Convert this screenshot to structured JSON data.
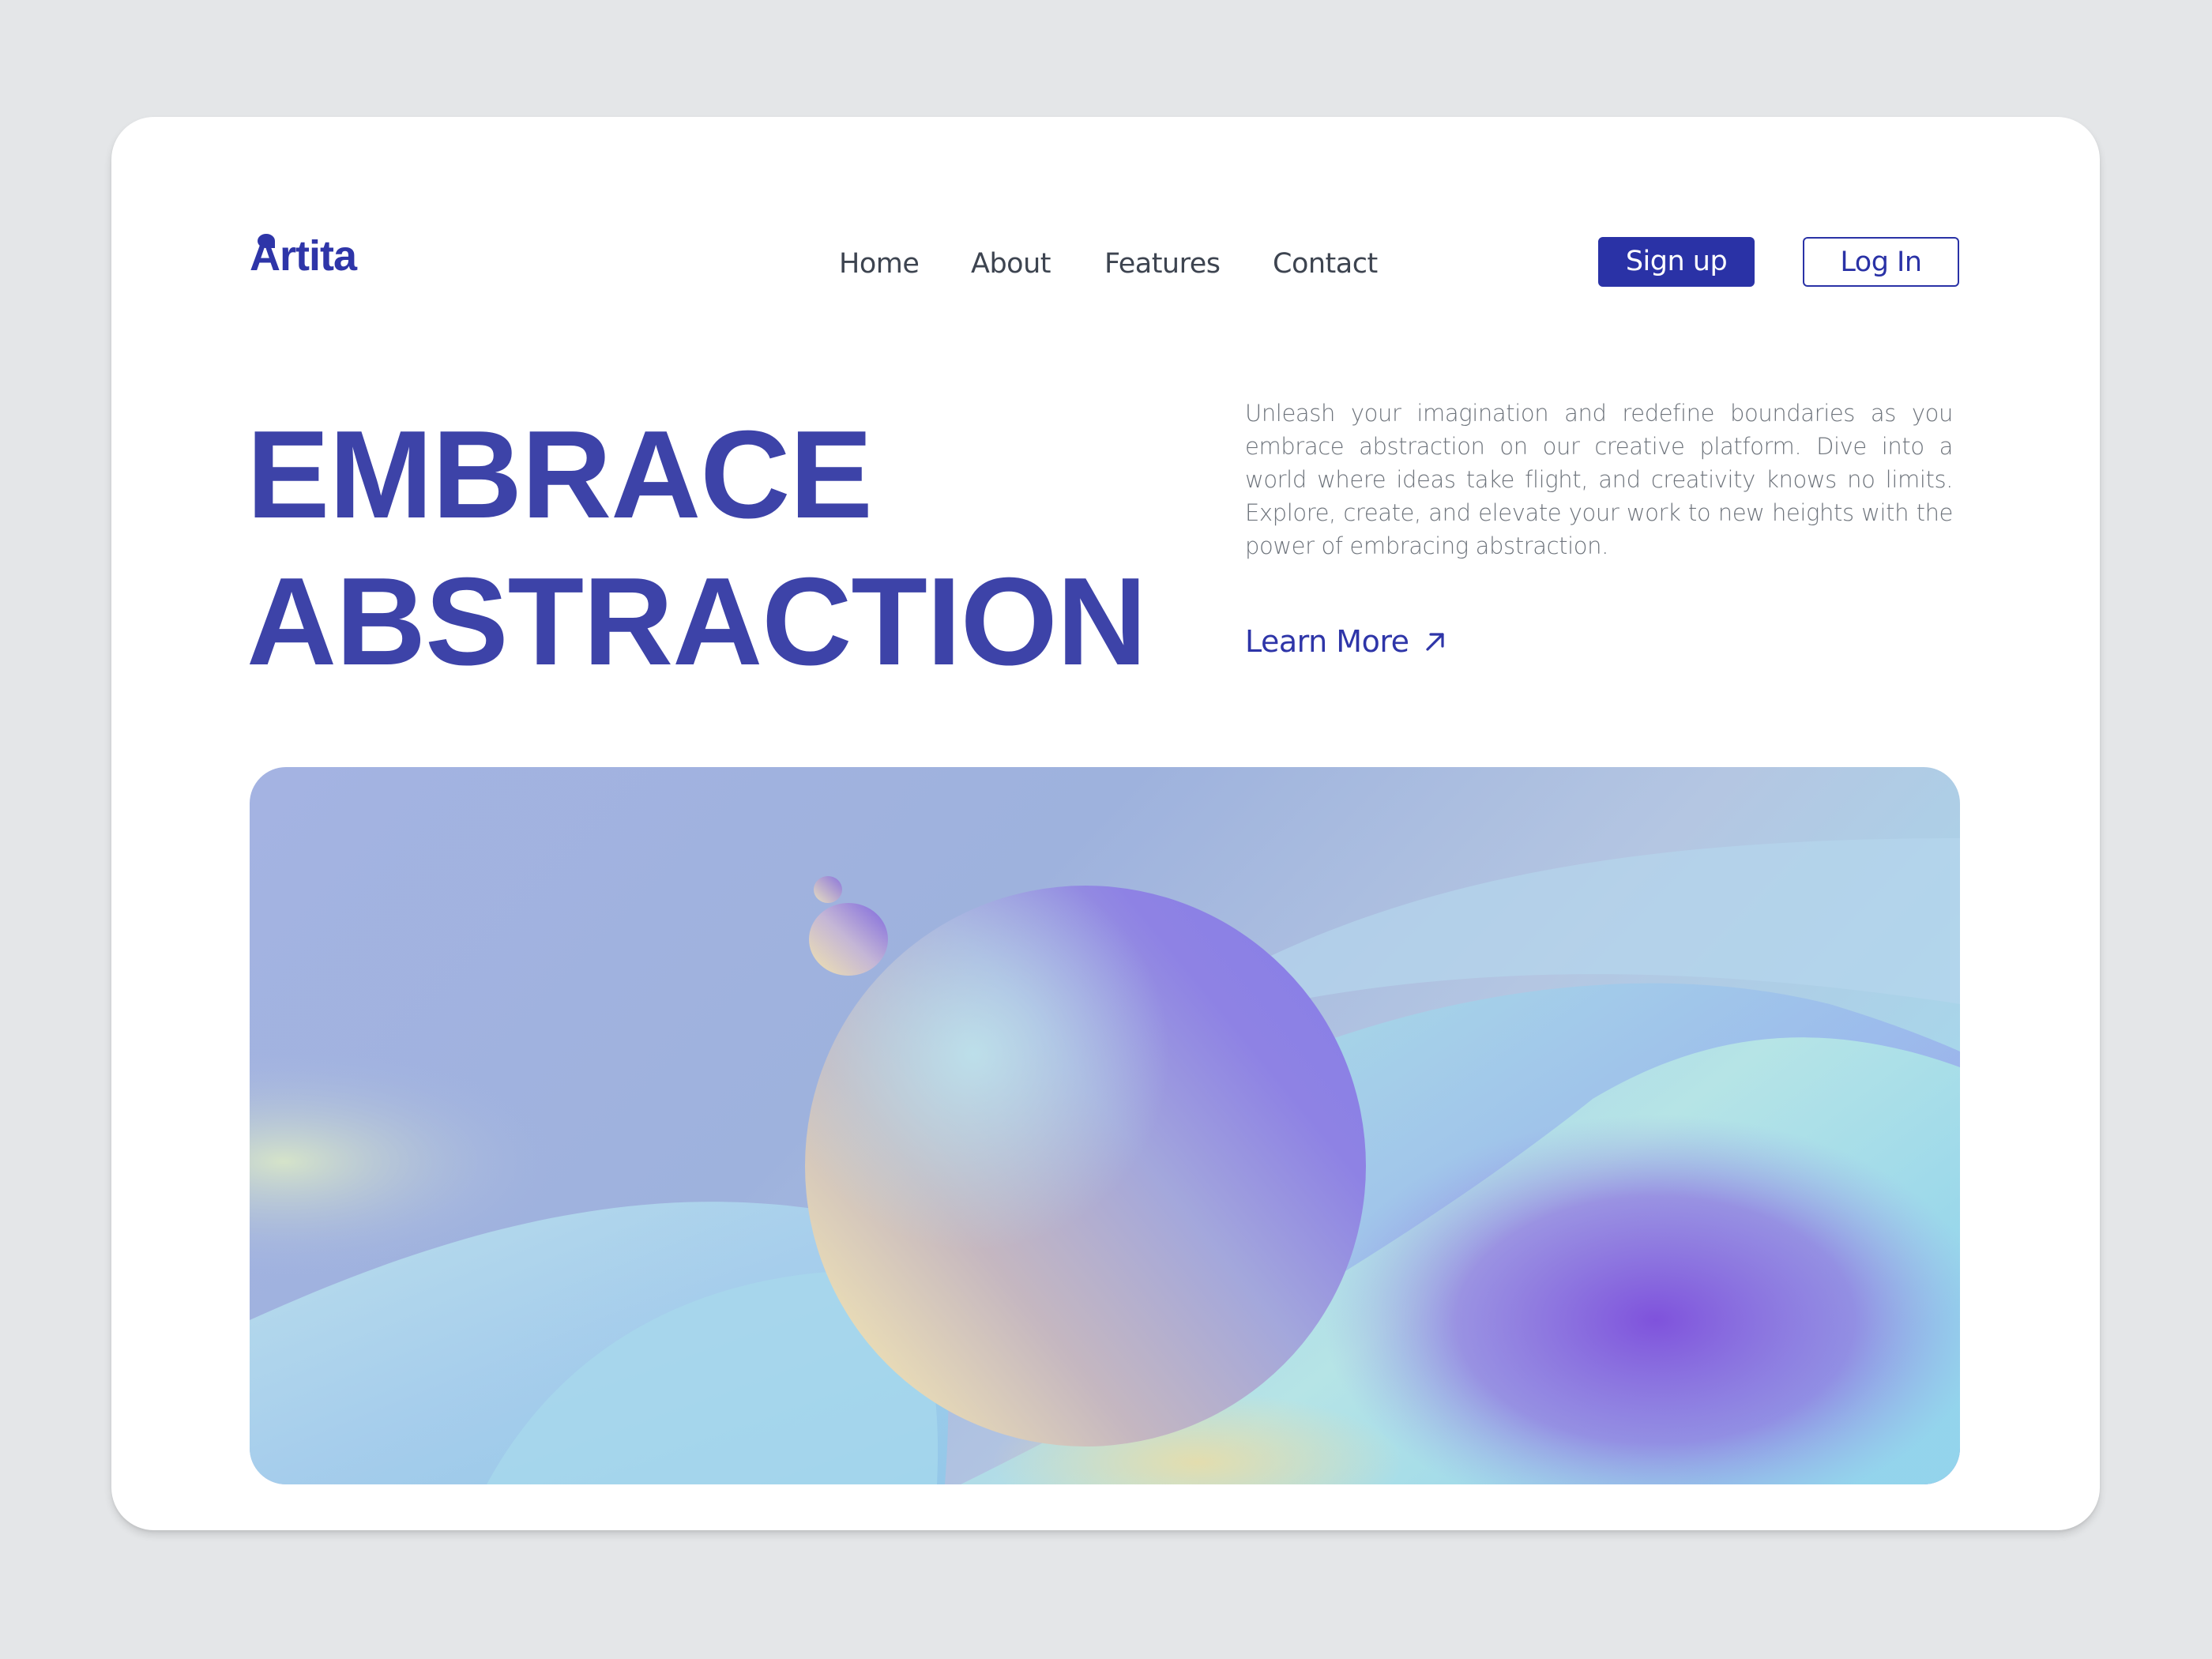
{
  "brand": {
    "name": "Artita",
    "color": "#2e35a8"
  },
  "nav": {
    "items": [
      "Home",
      "About",
      "Features",
      "Contact"
    ]
  },
  "auth": {
    "signup_label": "Sign up",
    "login_label": "Log In"
  },
  "hero": {
    "title_line1": "EMBRACE",
    "title_line2": "ABSTRACTION",
    "description": "Unleash your imagination and redefine boundaries as you embrace abstraction on our creative platform. Dive into a world where ideas take flight, and creativity knows no limits. Explore, create, and elevate your work to new heights with the power of embracing abstraction.",
    "cta_label": "Learn More",
    "cta_icon": "arrow-up-right-icon"
  },
  "colors": {
    "accent": "#2a32a6",
    "headline": "#3d43a8",
    "body_text": "#6e747c",
    "page_background": "#e4e6e8"
  }
}
